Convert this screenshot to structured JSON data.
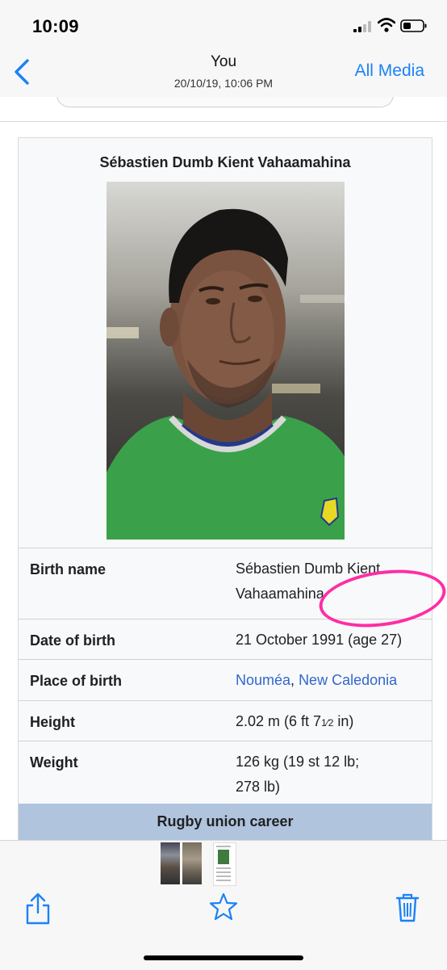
{
  "status_bar": {
    "time": "10:09"
  },
  "header": {
    "title": "You",
    "subtitle": "20/10/19, 10:06 PM",
    "all_media_label": "All Media"
  },
  "infobox": {
    "title": "Sébastien Dumb Kient Vahaamahina",
    "rows": [
      {
        "label": "Birth name",
        "value_line1": "Sébastien Dumb Kient",
        "value_line2": "Vahaamahina"
      },
      {
        "label": "Date of birth",
        "value": "21 October 1991 (age 27)"
      },
      {
        "label": "Place of birth",
        "link1": "Nouméa",
        "sep": ", ",
        "link2": "New Caledonia"
      },
      {
        "label": "Height",
        "value": "2.02 m (6 ft 7",
        "frac": "1⁄2",
        "value_end": " in)"
      },
      {
        "label": "Weight",
        "value_line1": "126 kg (19 st 12 lb;",
        "value_line2": "278 lb)"
      }
    ],
    "section_header": "Rugby union career"
  },
  "annotation": {
    "circle_color": "#ff2da5"
  },
  "toolbar": {
    "share_icon": "share-icon",
    "favorite_icon": "star-icon",
    "delete_icon": "trash-icon"
  },
  "colors": {
    "accent": "#1a82f7",
    "link": "#3366cc",
    "career_header": "#b0c4de"
  }
}
